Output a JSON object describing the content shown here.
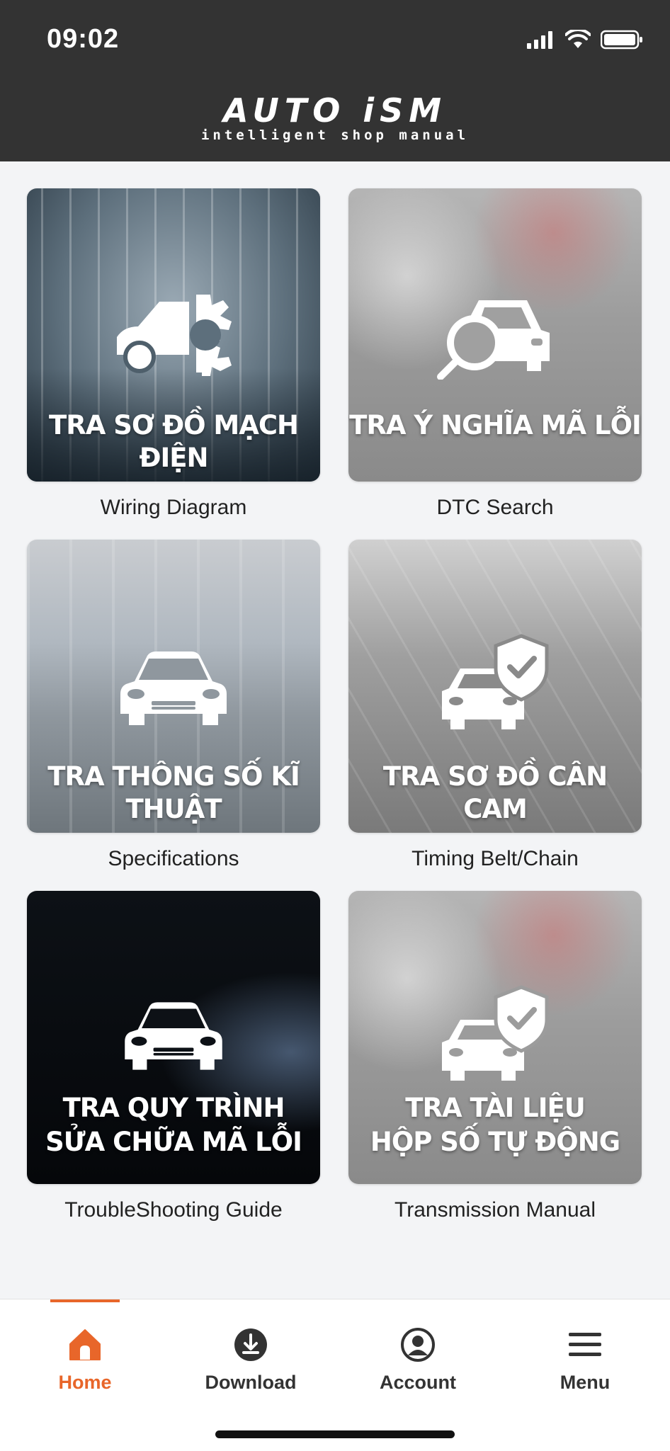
{
  "status_bar": {
    "time": "09:02"
  },
  "header": {
    "brand": "AUTO iSM",
    "tagline": "intelligent shop manual"
  },
  "cards": [
    {
      "title_line1": "TRA SƠ ĐỒ MẠCH ĐIỆN",
      "title_line2": "",
      "caption": "Wiring Diagram",
      "icon": "car-gear-icon"
    },
    {
      "title_line1": "TRA Ý NGHĨA MÃ LỖI",
      "title_line2": "",
      "caption": "DTC Search",
      "icon": "car-search-icon"
    },
    {
      "title_line1": "TRA THÔNG SỐ KĨ THUẬT",
      "title_line2": "",
      "caption": "Specifications",
      "icon": "car-front-icon"
    },
    {
      "title_line1": "TRA SƠ ĐỒ CÂN CAM",
      "title_line2": "",
      "caption": "Timing Belt/Chain",
      "icon": "car-shield-icon"
    },
    {
      "title_line1": "TRA QUY TRÌNH",
      "title_line2": "SỬA CHỮA MÃ LỖI",
      "caption": "TroubleShooting Guide",
      "icon": "car-front-icon"
    },
    {
      "title_line1": "TRA TÀI LIỆU",
      "title_line2": "HỘP SỐ TỰ ĐỘNG",
      "caption": "Transmission Manual",
      "icon": "car-shield-icon"
    }
  ],
  "nav": [
    {
      "label": "Home",
      "icon": "home-icon",
      "active": true
    },
    {
      "label": "Download",
      "icon": "download-icon",
      "active": false
    },
    {
      "label": "Account",
      "icon": "account-icon",
      "active": false
    },
    {
      "label": "Menu",
      "icon": "menu-icon",
      "active": false
    }
  ],
  "colors": {
    "accent": "#e8662a",
    "header_bg": "#333333",
    "page_bg": "#f3f4f6"
  }
}
